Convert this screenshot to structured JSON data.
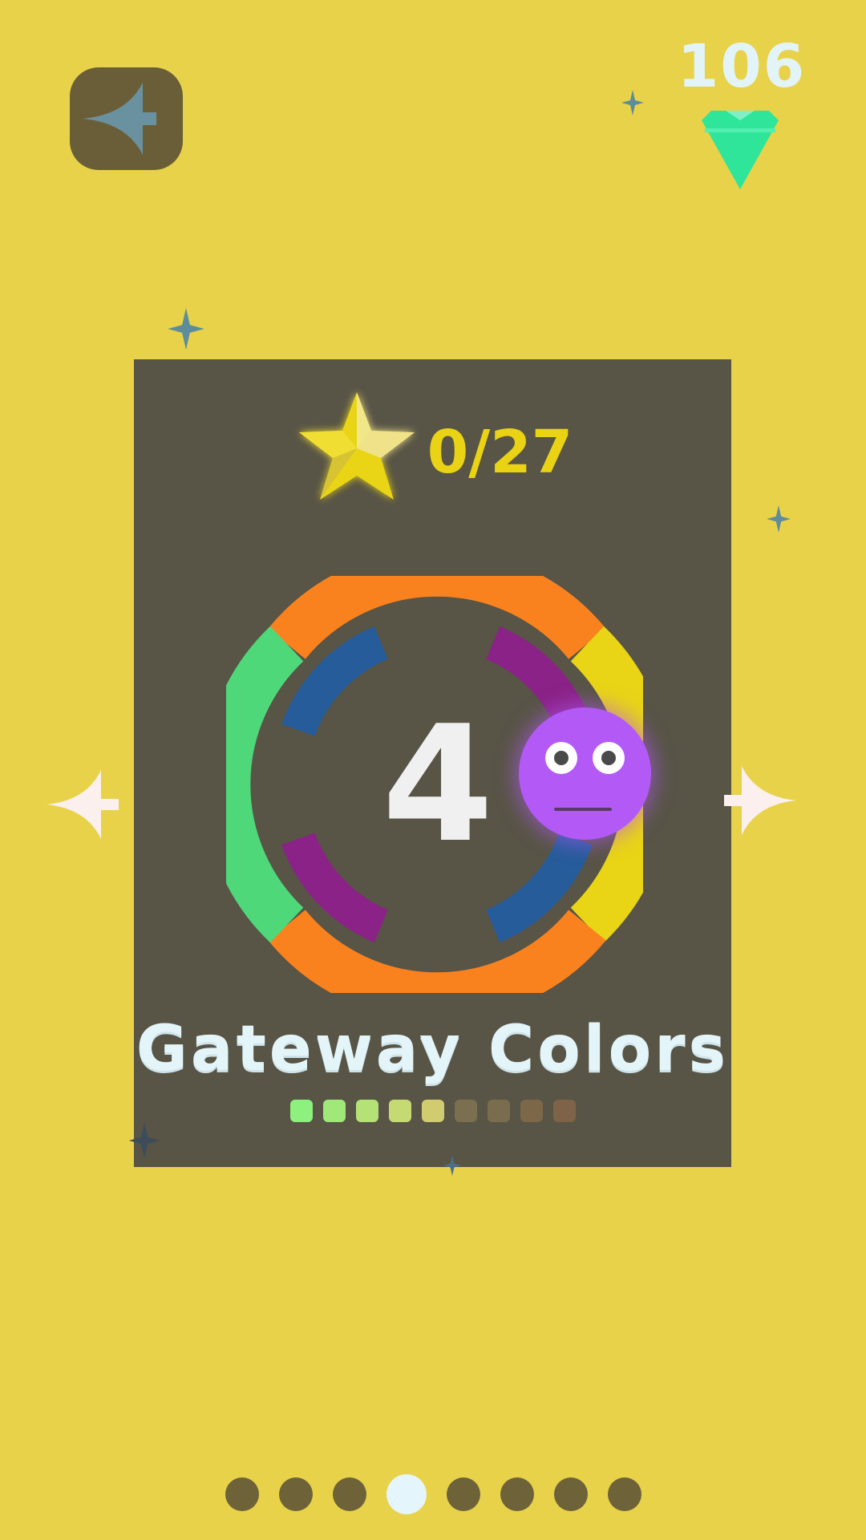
{
  "header": {
    "back_icon": "back-arrow-icon",
    "gem_count": "106",
    "gem_icon": "gem-icon",
    "gem_color": "#2ee59a"
  },
  "level_card": {
    "star_icon": "star-icon",
    "stars_collected": "0/27",
    "level_number": "4",
    "title": "Gateway Colors",
    "player_icon": "face-ball-icon",
    "progress_colors": [
      "#8ef07e",
      "#a0e87a",
      "#b5e276",
      "#c6da74",
      "#d1cc70",
      "#7a7050",
      "#7a6d4e",
      "#7c6749",
      "#7f6348"
    ]
  },
  "navigation": {
    "prev_icon": "prev-arrow-icon",
    "next_icon": "next-arrow-icon",
    "page_count": 8,
    "active_page": 4
  },
  "colors": {
    "background": "#e8d24a",
    "card": "#585446",
    "orange": "#fa821e",
    "green": "#4fd87a",
    "yellow": "#e9d516",
    "blue": "#265c9a",
    "purple": "#8a2287",
    "ball": "#b35af6"
  }
}
